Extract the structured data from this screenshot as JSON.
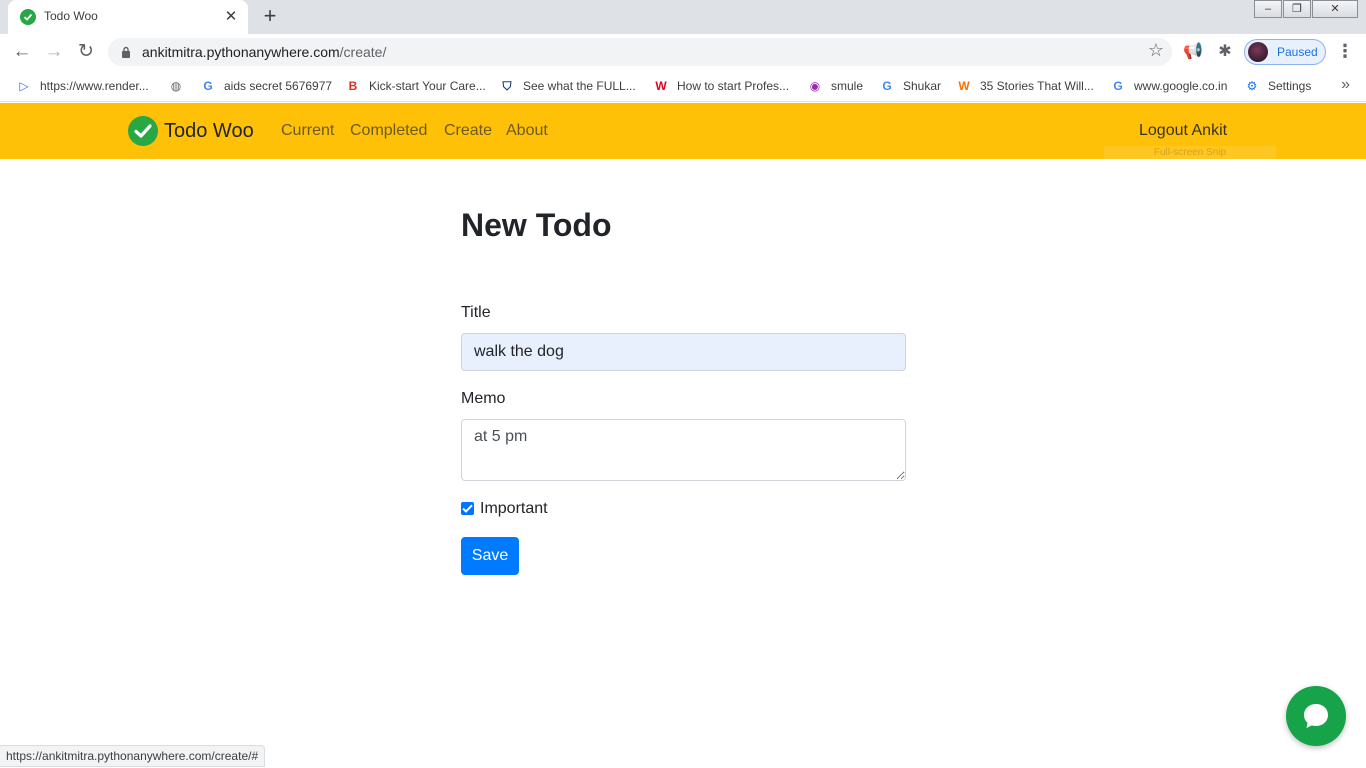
{
  "browser": {
    "tab_title": "Todo Woo",
    "url_host": "ankitmitra.pythonanywhere.com",
    "url_path": "/create/",
    "profile_label": "Paused",
    "status_url": "https://ankitmitra.pythonanywhere.com/create/#"
  },
  "bookmarks": [
    {
      "label": "https://www.render...",
      "icon": "bing-icon",
      "color": "#2f6fe0",
      "glyph": "▷"
    },
    {
      "label": "",
      "icon": "globe-icon",
      "color": "#5f6368",
      "glyph": "◍"
    },
    {
      "label": "aids secret 5676977",
      "icon": "google-icon",
      "color": "#4285f4",
      "glyph": "G"
    },
    {
      "label": "Kick-start Your Care...",
      "icon": "b-logo-icon",
      "color": "#d93025",
      "glyph": "B"
    },
    {
      "label": "See what the FULL...",
      "icon": "shield-icon",
      "color": "#1a3c8a",
      "glyph": "⛉"
    },
    {
      "label": "How to start Profes...",
      "icon": "w-red-icon",
      "color": "#e60023",
      "glyph": "W"
    },
    {
      "label": "smule",
      "icon": "podcast-icon",
      "color": "#9c27b0",
      "glyph": "◉"
    },
    {
      "label": "Shukar",
      "icon": "google-icon",
      "color": "#4285f4",
      "glyph": "G"
    },
    {
      "label": "35 Stories That Will...",
      "icon": "w-orange-icon",
      "color": "#ff6f00",
      "glyph": "W"
    },
    {
      "label": "www.google.co.in",
      "icon": "google-icon",
      "color": "#4285f4",
      "glyph": "G"
    },
    {
      "label": "Settings",
      "icon": "gear-icon",
      "color": "#1a73e8",
      "glyph": "⚙"
    }
  ],
  "navbar": {
    "brand": "Todo Woo",
    "links": [
      "Current",
      "Completed",
      "Create",
      "About"
    ],
    "logout": "Logout Ankit",
    "snip_text": "Full-screen Snip"
  },
  "form": {
    "heading": "New Todo",
    "title_label": "Title",
    "title_value": "walk the dog",
    "memo_label": "Memo",
    "memo_value": "at 5 pm",
    "important_label": "Important",
    "important_checked": true,
    "save_label": "Save"
  },
  "colors": {
    "navbar_bg": "#ffc107",
    "primary": "#007bff",
    "brand_green": "#28a745"
  }
}
